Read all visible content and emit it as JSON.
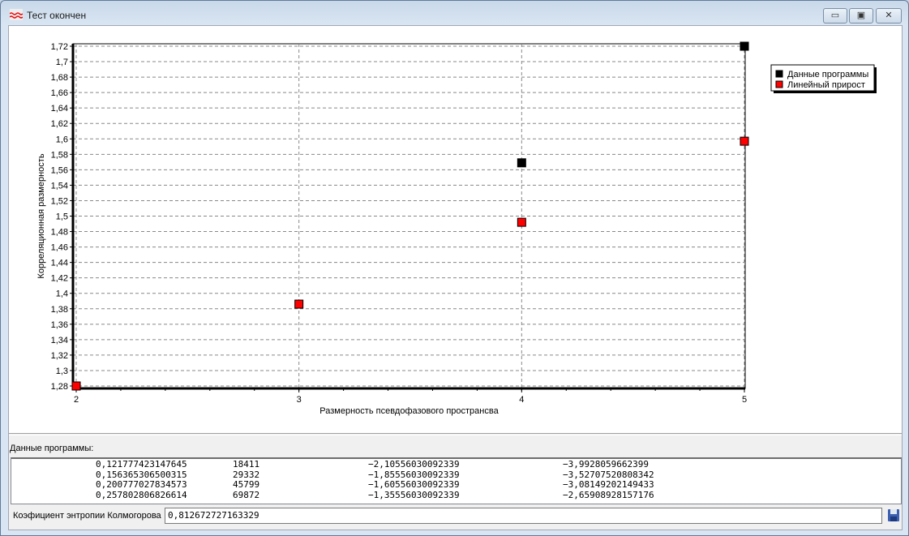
{
  "window": {
    "title": "Тест окончен",
    "app_icon": "wave-chart-icon",
    "buttons": {
      "minimize": "minimize-icon",
      "maximize": "restore-icon",
      "close": "close-icon"
    }
  },
  "chart_data": {
    "type": "scatter",
    "xlabel": "Размерность псевдофазового пространсва",
    "ylabel": "Корреляционная размерность",
    "xlim": [
      2,
      5
    ],
    "ylim": [
      1.28,
      1.72
    ],
    "x_ticks": [
      "2",
      "3",
      "4",
      "5"
    ],
    "y_ticks": [
      "1,28",
      "1,3",
      "1,32",
      "1,34",
      "1,36",
      "1,38",
      "1,4",
      "1,42",
      "1,44",
      "1,46",
      "1,48",
      "1,5",
      "1,52",
      "1,54",
      "1,56",
      "1,58",
      "1,6",
      "1,62",
      "1,64",
      "1,66",
      "1,68",
      "1,7",
      "1,72"
    ],
    "grid": true,
    "legend_position": "right",
    "series": [
      {
        "name": "Данные программы",
        "color": "#000000",
        "points": [
          [
            4,
            1.569
          ],
          [
            5,
            1.72
          ]
        ]
      },
      {
        "name": "Линейный прирост",
        "color": "#ff0000",
        "points": [
          [
            2,
            1.28
          ],
          [
            3,
            1.386
          ],
          [
            4,
            1.492
          ],
          [
            5,
            1.597
          ]
        ]
      }
    ]
  },
  "data_panel": {
    "label": "Данные программы:",
    "rows": [
      [
        "0,121777423147645",
        "18411",
        "−2,10556030092339",
        "−3,9928059662399"
      ],
      [
        "0,156365306500315",
        "29332",
        "−1,85556030092339",
        "−3,52707520808342"
      ],
      [
        "0,200777027834573",
        "45799",
        "−1,60556030092339",
        "−3,08149202149433"
      ],
      [
        "0,257802806826614",
        "69872",
        "−1,35556030092339",
        "−2,65908928157176"
      ]
    ]
  },
  "entropy": {
    "label": "Коэфициент энтропии Колмогорова",
    "value": "0,812672727163329",
    "save_icon": "floppy-disk-icon"
  }
}
